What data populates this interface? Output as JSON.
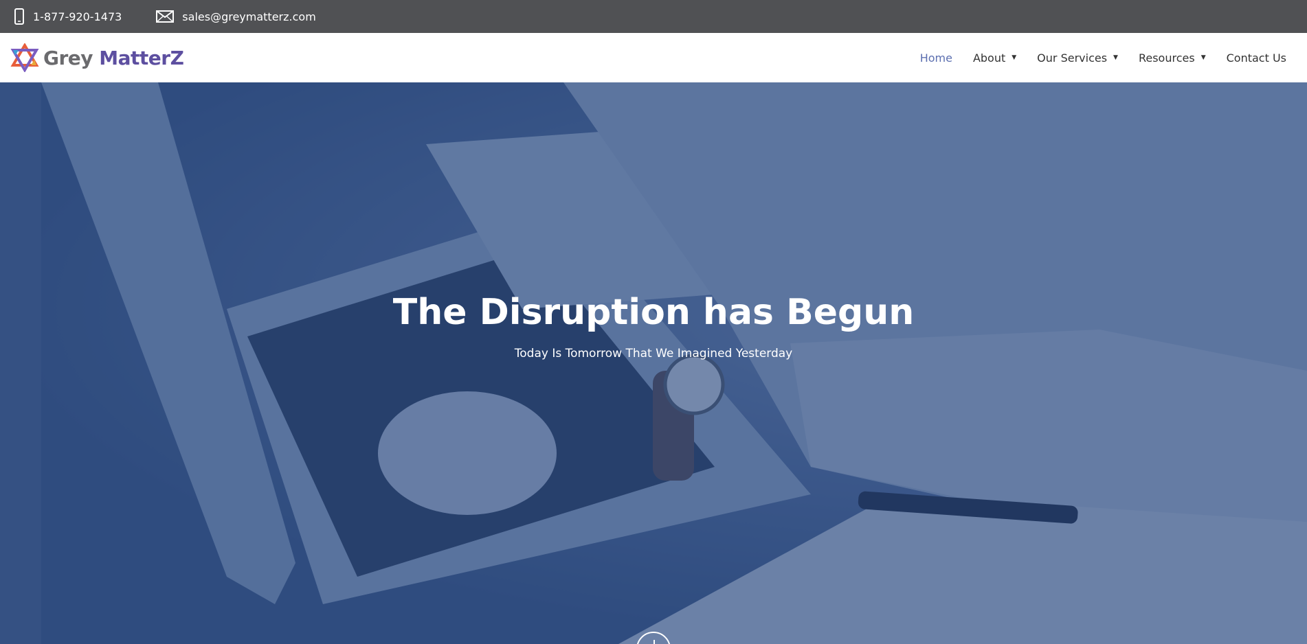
{
  "topbar": {
    "phone": "1-877-920-1473",
    "email": "sales@greymatterz.com",
    "icons": [
      "mobile-phone-icon",
      "envelope-icon"
    ]
  },
  "header": {
    "logo": {
      "grey": "Grey ",
      "mz": "MatterZ"
    },
    "nav": [
      {
        "label": "Home",
        "active": true,
        "dropdown": false
      },
      {
        "label": "About",
        "active": false,
        "dropdown": true
      },
      {
        "label": "Our Services",
        "active": false,
        "dropdown": true
      },
      {
        "label": "Resources",
        "active": false,
        "dropdown": true
      },
      {
        "label": "Contact Us",
        "active": false,
        "dropdown": false
      }
    ]
  },
  "hero": {
    "title": "The Disruption has Begun",
    "subtitle": "Today Is Tomorrow That We Imagined Yesterday"
  },
  "colors": {
    "topbar_bg": "#505154",
    "nav_active": "#5c6fb0",
    "brand_purple": "#5d4fa0",
    "brand_grey": "#6b6b6e",
    "hero_overlay": "#244278"
  }
}
